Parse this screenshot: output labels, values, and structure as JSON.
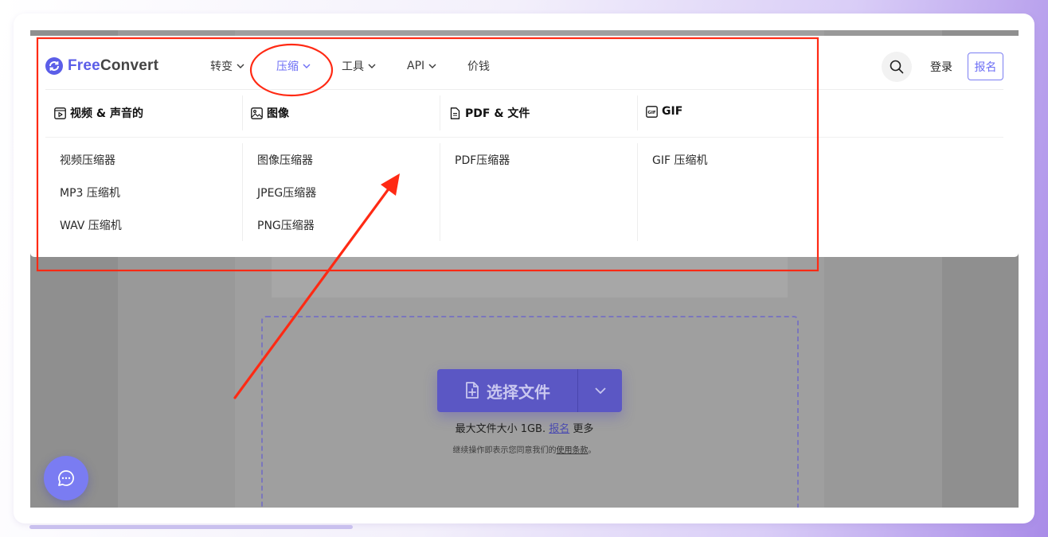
{
  "brand": {
    "prefix": "Free",
    "suffix": "Convert"
  },
  "nav": {
    "convert": "转变",
    "compress": "压缩",
    "tools": "工具",
    "api": "API",
    "pricing": "价钱"
  },
  "header": {
    "login": "登录",
    "signup": "报名"
  },
  "colors": {
    "accent": "#6c6ef5",
    "annotation": "#ff2a14",
    "overlay": "#8f8f8f"
  },
  "menu": {
    "columns": [
      {
        "icon": "video-icon",
        "title": "视频 & 声音的",
        "items": [
          "视频压缩器",
          "MP3 压缩机",
          "WAV 压缩机"
        ]
      },
      {
        "icon": "image-icon",
        "title": "图像",
        "items": [
          "图像压缩器",
          "JPEG压缩器",
          "PNG压缩器"
        ]
      },
      {
        "icon": "document-icon",
        "title": "PDF & 文件",
        "items": [
          "PDF压缩器"
        ]
      },
      {
        "icon": "gif-icon",
        "title": "GIF",
        "items": [
          "GIF 压缩机"
        ]
      }
    ]
  },
  "upload": {
    "button": "选择文件",
    "max_prefix": "最大文件大小 1GB.",
    "max_link": "报名",
    "max_suffix": " 更多",
    "terms_prefix": "继续操作即表示您同意我们的",
    "terms_link": "使用条款",
    "terms_suffix": "。"
  }
}
